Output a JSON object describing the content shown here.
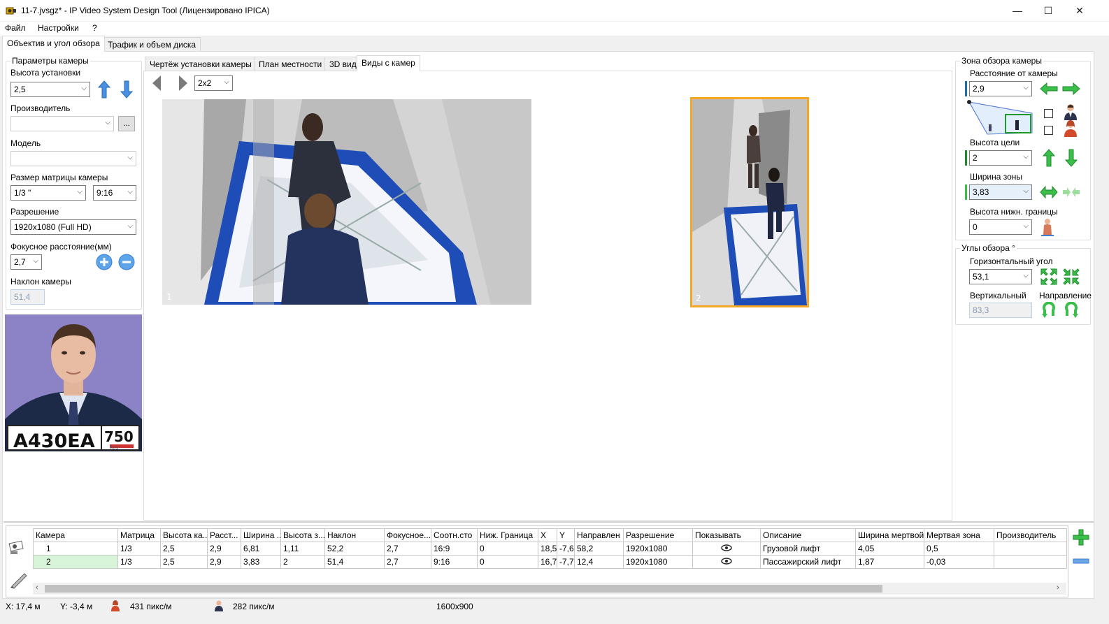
{
  "window": {
    "title": "11-7.jvsgz* - IP Video System Design Tool (Лицензировано  IPICA)",
    "minimize": "—",
    "maximize": "☐",
    "close": "✕"
  },
  "menu": [
    "Файл",
    "Настройки",
    "?"
  ],
  "main_tabs": [
    "Объектив и угол обзора",
    "Трафик и объем диска"
  ],
  "left": {
    "group_title": "Параметры камеры",
    "height_label": "Высота установки",
    "height_value": "2,5",
    "manufacturer_label": "Производитель",
    "manufacturer_value": "",
    "manufacturer_btn": "...",
    "model_label": "Модель",
    "model_value": "",
    "sensor_label": "Размер матрицы камеры",
    "sensor_value": "1/3 \"",
    "aspect_value": "9:16",
    "resolution_label": "Разрешение",
    "resolution_value": "1920x1080 (Full HD)",
    "focal_label": "Фокусное расстояние(мм)",
    "focal_value": "2,7",
    "tilt_label": "Наклон камеры",
    "tilt_value": "51,4",
    "plate_letters": "A430EA",
    "plate_region": "750",
    "plate_country": "RUS"
  },
  "center": {
    "tabs": [
      "Чертёж установки камеры",
      "План местности",
      "3D вид",
      "Виды с камер"
    ],
    "layout_value": "2x2",
    "view1_label": "1",
    "view2_label": "2"
  },
  "right": {
    "zone_title": "Зона обзора камеры",
    "distance_label": "Расстояние от камеры",
    "distance_value": "2,9",
    "target_height_label": "Высота цели",
    "target_height_value": "2",
    "zone_width_label": "Ширина зоны",
    "zone_width_value": "3,83",
    "lower_bound_label": "Высота нижн. границы",
    "lower_bound_value": "0",
    "angles_title": "Углы обзора °",
    "horiz_label": "Горизонтальный угол",
    "horiz_value": "53,1",
    "vert_label": "Вертикальный",
    "vert_value": "83,3",
    "direction_label": "Направление"
  },
  "table": {
    "columns": [
      "Камера",
      "Матрица",
      "Высота ка...",
      "Расст...",
      "Ширина ...",
      "Высота з...",
      "Наклон",
      "Фокусное...",
      "Соотн.сто",
      "Ниж. Граница",
      "X",
      "Y",
      "Направлен",
      "Разрешение",
      "Показывать",
      "Описание",
      "Ширина мертвой...",
      "Мертвая зона",
      "Производитель"
    ],
    "rows": [
      [
        "1",
        "1/3",
        "2,5",
        "2,9",
        "6,81",
        "1,11",
        "52,2",
        "2,7",
        "16:9",
        "0",
        "18,5",
        "-7,6",
        "58,2",
        "1920x1080",
        "",
        "Грузовой лифт",
        "4,05",
        "0,5",
        ""
      ],
      [
        "2",
        "1/3",
        "2,5",
        "2,9",
        "3,83",
        "2",
        "51,4",
        "2,7",
        "9:16",
        "0",
        "16,7",
        "-7,7",
        "12,4",
        "1920x1080",
        "",
        "Пассажирский лифт",
        "1,87",
        "-0,03",
        ""
      ]
    ]
  },
  "status": {
    "x": "X: 17,4 м",
    "y": "Y: -3,4 м",
    "density_female": "431 пикс/м",
    "density_male": "282 пикс/м",
    "resolution": "1600x900"
  },
  "colors": {
    "accent_blue": "#3b7fd6",
    "arrow_green": "#2fb24a",
    "selection_orange": "#f5a623",
    "avatar_bg": "#8d84c8"
  }
}
